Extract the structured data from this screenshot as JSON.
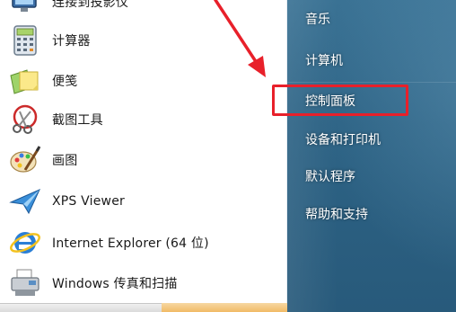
{
  "left_programs": [
    {
      "label": "连接到投影仪",
      "icon": "projector-icon"
    },
    {
      "label": "计算器",
      "icon": "calculator-icon"
    },
    {
      "label": "便笺",
      "icon": "sticky-notes-icon"
    },
    {
      "label": "截图工具",
      "icon": "snipping-tool-icon"
    },
    {
      "label": "画图",
      "icon": "paint-icon"
    },
    {
      "label": "XPS Viewer",
      "icon": "xps-viewer-icon"
    },
    {
      "label": "Internet Explorer (64 位)",
      "icon": "internet-explorer-icon"
    },
    {
      "label": "Windows 传真和扫描",
      "icon": "fax-scan-icon"
    }
  ],
  "right_links": [
    {
      "label": "音乐"
    },
    {
      "label": "计算机"
    },
    {
      "label": "控制面板"
    },
    {
      "label": "设备和打印机"
    },
    {
      "label": "默认程序"
    },
    {
      "label": "帮助和支持"
    }
  ],
  "annotation": {
    "highlight_color": "#e8202a",
    "highlighted_item": "控制面板"
  },
  "colors": {
    "right_pane": "#2d6385",
    "left_pane": "#ffffff"
  }
}
